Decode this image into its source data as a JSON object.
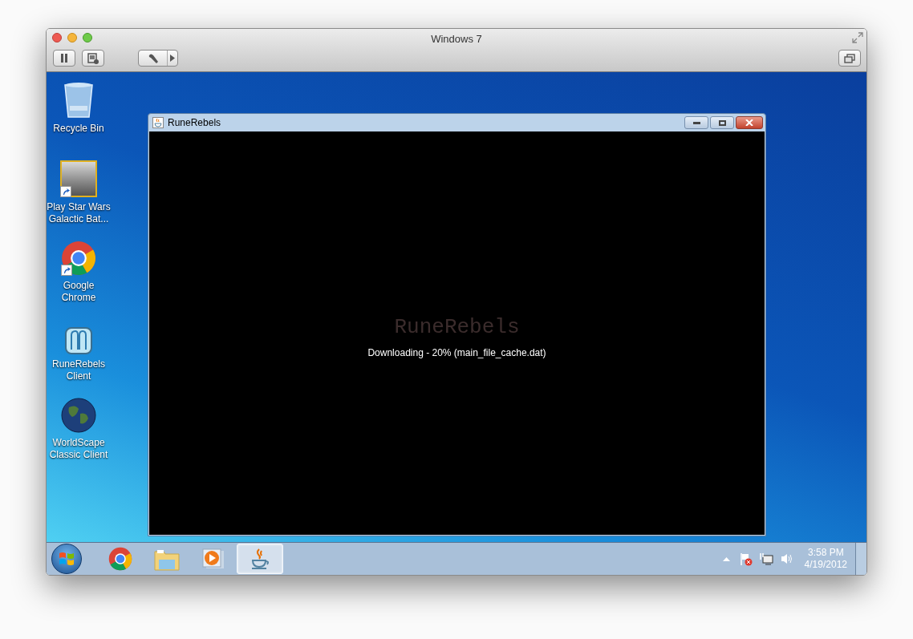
{
  "window": {
    "title": "Windows 7"
  },
  "desktop_icons": [
    {
      "kind": "recycle",
      "lines": [
        "Recycle Bin"
      ],
      "shortcut": false
    },
    {
      "kind": "game",
      "lines": [
        "Play Star Wars",
        "Galactic Bat..."
      ],
      "shortcut": true
    },
    {
      "kind": "chrome",
      "lines": [
        "Google",
        "Chrome"
      ],
      "shortcut": true
    },
    {
      "kind": "rune",
      "lines": [
        "RuneRebels",
        "Client"
      ],
      "shortcut": false
    },
    {
      "kind": "globe",
      "lines": [
        "WorldScape",
        "Classic Client"
      ],
      "shortcut": false
    }
  ],
  "app_window": {
    "title": "RuneRebels",
    "logo": "RuneRebels",
    "status": "Downloading - 20% (main_file_cache.dat)"
  },
  "taskbar": {
    "items": [
      {
        "kind": "chrome",
        "selected": false
      },
      {
        "kind": "folder",
        "selected": false
      },
      {
        "kind": "media",
        "selected": false
      },
      {
        "kind": "java",
        "selected": true
      }
    ],
    "clock": {
      "time": "3:58 PM",
      "date": "4/19/2012"
    }
  }
}
